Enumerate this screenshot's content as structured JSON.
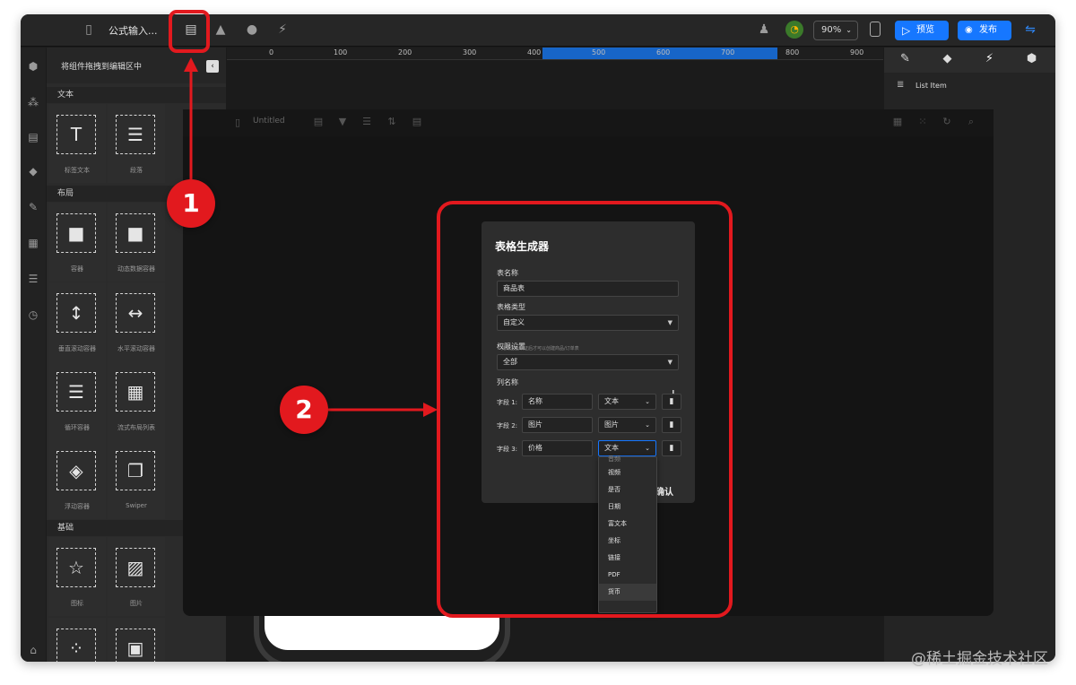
{
  "window": {
    "page_title": "公式输入...",
    "zoom": "90%",
    "preview_label": "预览",
    "publish_label": "发布"
  },
  "panel": {
    "header": "将组件拖拽到编辑区中",
    "sections": [
      {
        "title": "文本",
        "items": [
          {
            "label": "标签文本",
            "glyph": "T"
          },
          {
            "label": "段落",
            "glyph": "☰"
          }
        ]
      },
      {
        "title": "布局",
        "items": [
          {
            "label": "容器",
            "glyph": "■"
          },
          {
            "label": "动态数据容器",
            "glyph": "■"
          },
          {
            "label": "垂直滚动容器",
            "glyph": "↕"
          },
          {
            "label": "水平滚动容器",
            "glyph": "↔"
          },
          {
            "label": "循环容器",
            "glyph": "☰"
          },
          {
            "label": "流式布局列表",
            "glyph": "▦"
          },
          {
            "label": "浮动容器",
            "glyph": "◈"
          },
          {
            "label": "Swiper",
            "glyph": "❐"
          }
        ]
      },
      {
        "title": "基础",
        "items": [
          {
            "label": "图标",
            "glyph": "☆"
          },
          {
            "label": "图片",
            "glyph": "▨"
          }
        ]
      }
    ]
  },
  "ruler": {
    "labels": [
      "0",
      "100",
      "200",
      "300",
      "400",
      "500",
      "600",
      "700",
      "800",
      "900"
    ]
  },
  "right_panel": {
    "list_item": "List Item",
    "tabs": [
      "brush-icon",
      "diamond-icon",
      "bolt-icon",
      "cube-icon"
    ]
  },
  "modal": {
    "untitled": "Untitled"
  },
  "dialog": {
    "title": "表格生成器",
    "table_name_label": "表名称",
    "table_name_value": "商品表",
    "table_type_label": "表格类型",
    "table_type_value": "自定义",
    "hint": "完成企业认证后才可以创建商品/订单表",
    "permission_label": "权限设置",
    "permission_value": "全部",
    "columns_label": "列名称",
    "confirm": "确认",
    "fields": [
      {
        "label": "字段 1:",
        "name": "名称",
        "type": "文本"
      },
      {
        "label": "字段 2:",
        "name": "图片",
        "type": "图片"
      },
      {
        "label": "字段 3:",
        "name": "价格",
        "type": "文本"
      }
    ]
  },
  "dropdown": {
    "options": [
      "音频",
      "视频",
      "是否",
      "日期",
      "富文本",
      "坐标",
      "链接",
      "PDF",
      "货币"
    ]
  },
  "callouts": {
    "badge1": "1",
    "badge2": "2"
  },
  "watermark": "@稀土掘金技术社区",
  "colors": {
    "accent": "#1677ff",
    "highlight": "#e2191e"
  }
}
